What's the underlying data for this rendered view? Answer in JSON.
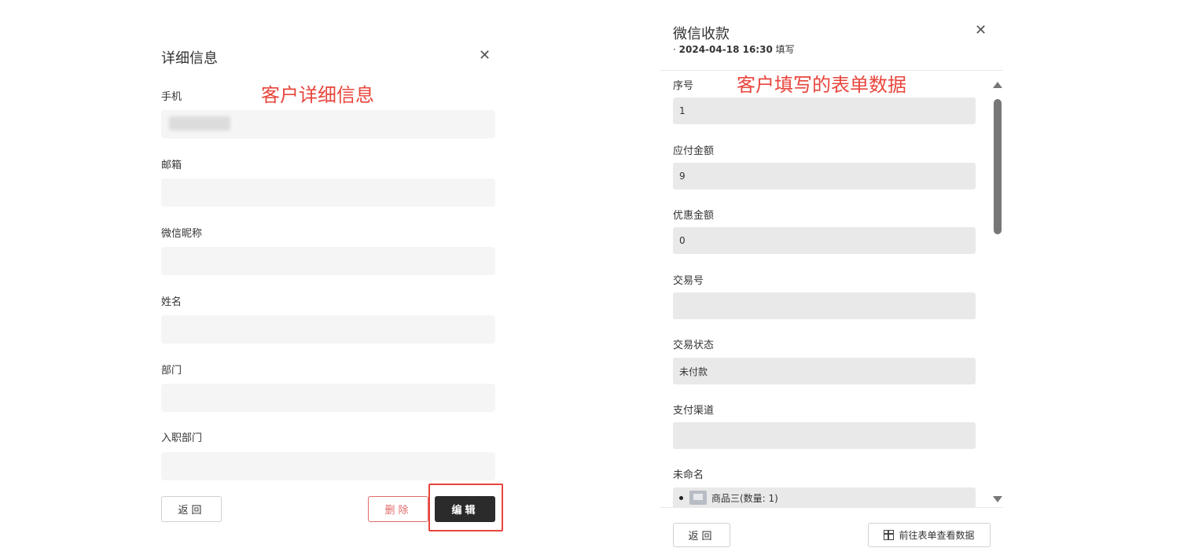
{
  "annotations": {
    "left": "客户详细信息",
    "right": "客户填写的表单数据"
  },
  "left_panel": {
    "title": "详细信息",
    "close_label": "✕",
    "fields": [
      {
        "label": "手机",
        "value": ""
      },
      {
        "label": "邮箱",
        "value": ""
      },
      {
        "label": "微信昵称",
        "value": ""
      },
      {
        "label": "姓名",
        "value": ""
      },
      {
        "label": "部门",
        "value": ""
      },
      {
        "label": "入职部门",
        "value": ""
      }
    ],
    "buttons": {
      "back": "返回",
      "delete": "删除",
      "edit": "编辑"
    }
  },
  "right_panel": {
    "title": "微信收款",
    "subtitle_prefix": "·",
    "subtitle_date": "2024-04-18 16:30",
    "subtitle_suffix": "填写",
    "close_label": "✕",
    "fields": [
      {
        "label": "序号",
        "value": "1"
      },
      {
        "label": "应付金额",
        "value": "9"
      },
      {
        "label": "优惠金额",
        "value": "0"
      },
      {
        "label": "交易号",
        "value": ""
      },
      {
        "label": "交易状态",
        "value": "未付款"
      },
      {
        "label": "支付渠道",
        "value": ""
      },
      {
        "label": "未命名",
        "value": ""
      }
    ],
    "product_item": "商品三(数量: 1)",
    "buttons": {
      "back": "返回",
      "goto_form": "前往表单查看数据"
    }
  }
}
